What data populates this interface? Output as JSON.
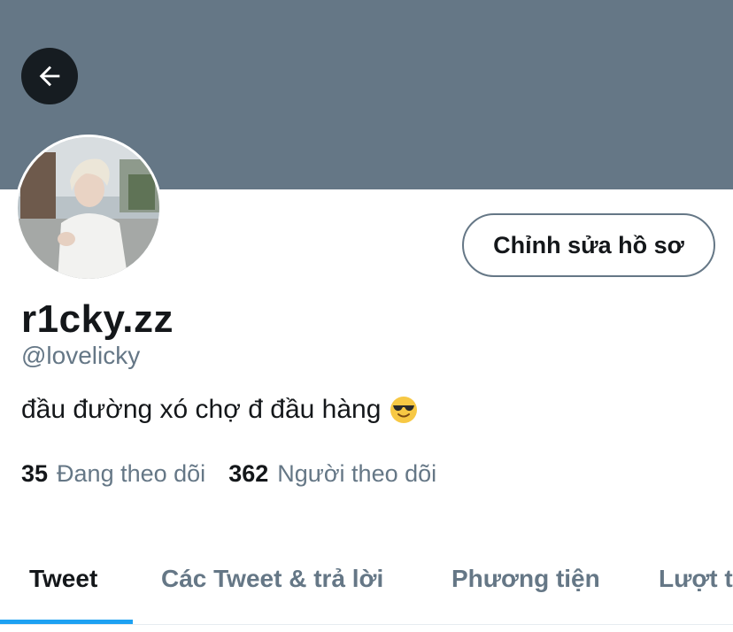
{
  "profile": {
    "display_name": "r1cky.zz",
    "handle": "@lovelicky",
    "bio": "đầu đường xó chợ đ đầu hàng",
    "bio_emoji": "smiling-face-with-sunglasses-icon",
    "edit_button": "Chỉnh sửa hồ sơ"
  },
  "stats": {
    "following_count": "35",
    "following_label": "Đang theo dõi",
    "followers_count": "362",
    "followers_label": "Người theo dõi"
  },
  "tabs": [
    {
      "label": "Tweet",
      "active": true
    },
    {
      "label": "Các Tweet & trả lời",
      "active": false
    },
    {
      "label": "Phương tiện",
      "active": false
    },
    {
      "label": "Lượt t",
      "active": false
    }
  ],
  "colors": {
    "banner": "#657786",
    "accent": "#1da1f2",
    "text": "#14171a",
    "secondary_text": "#657786"
  }
}
